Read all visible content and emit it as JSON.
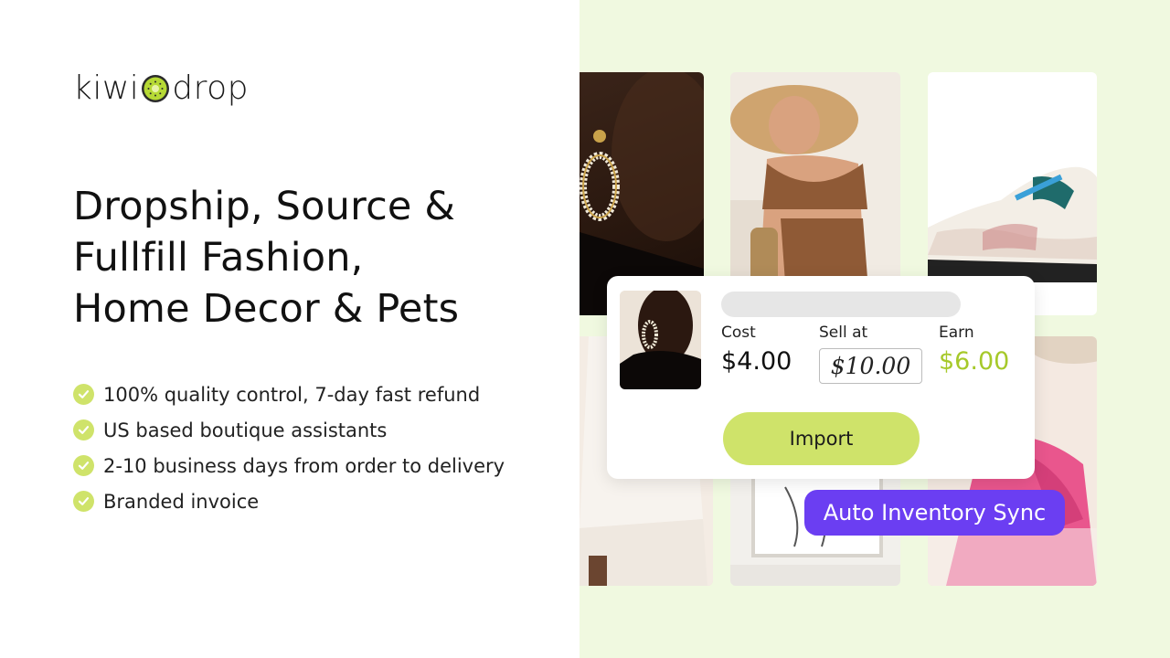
{
  "brand": {
    "logo_left": "kiwi",
    "logo_right": "drop",
    "logo_icon": "kiwi-fruit-icon"
  },
  "headline": {
    "lines": [
      "Dropship, Source &",
      "Fullfill Fashion,",
      "Home Decor & Pets"
    ]
  },
  "features": [
    {
      "text": "100% quality control, 7-day fast refund",
      "icon": "check-circle-icon"
    },
    {
      "text": "US based boutique assistants",
      "icon": "check-circle-icon"
    },
    {
      "text": "2-10 business days from order to delivery",
      "icon": "check-circle-icon"
    },
    {
      "text": "Branded invoice",
      "icon": "check-circle-icon"
    }
  ],
  "product_card": {
    "cost_label": "Cost",
    "cost_value": "$4.00",
    "sell_label": "Sell at",
    "sell_value": "$10.00",
    "earn_label": "Earn",
    "earn_value": "$6.00",
    "import_label": "Import"
  },
  "badge": {
    "label": "Auto Inventory Sync"
  },
  "colors": {
    "accent_green": "#cfe36a",
    "earn_green": "#a6c92a",
    "badge_purple": "#6b3ef2",
    "panel_bg": "#f0f9e0"
  }
}
